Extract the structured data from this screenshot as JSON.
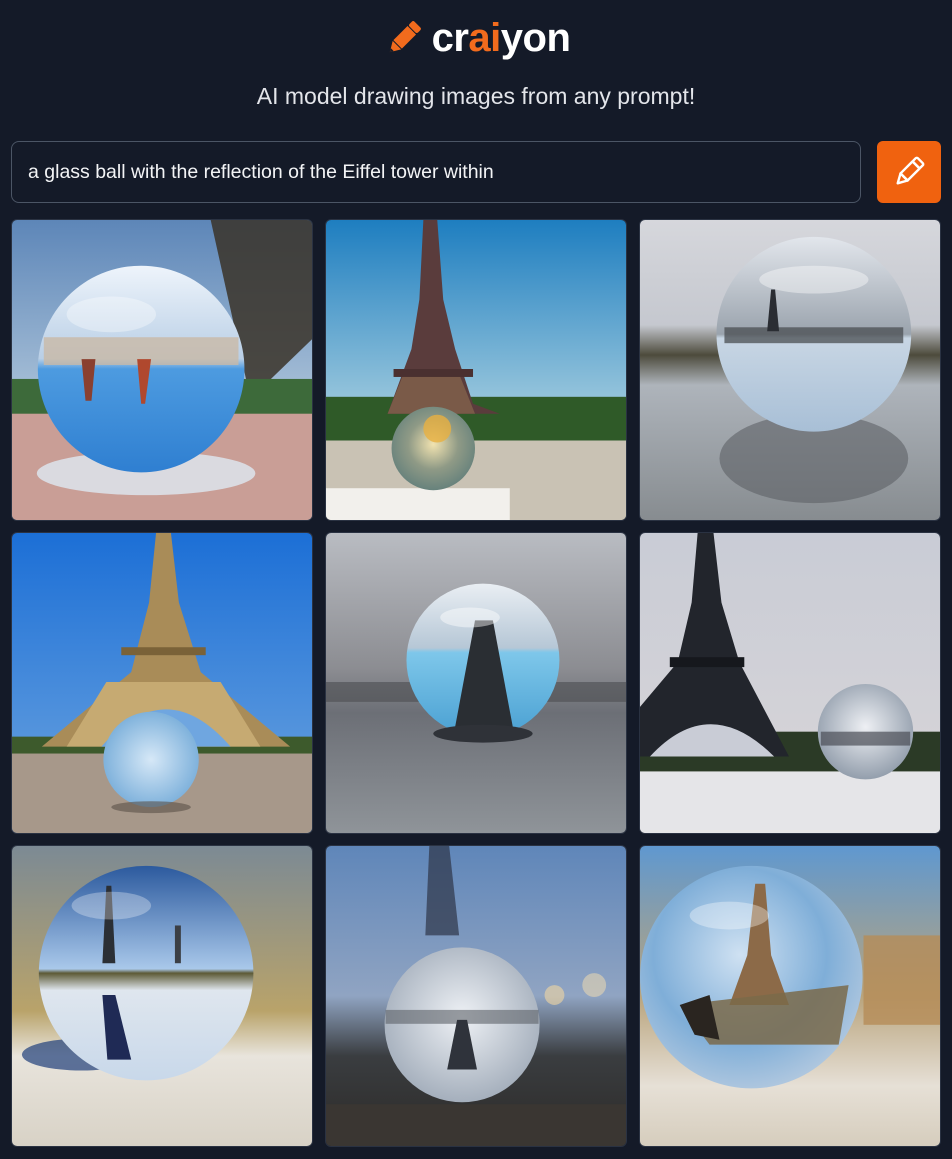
{
  "header": {
    "brand_prefix": "cr",
    "brand_accent": "ai",
    "brand_suffix": "yon",
    "brand_icon": "pencil-icon",
    "tagline": "AI model drawing images from any prompt!"
  },
  "prompt": {
    "value": "a glass ball with the reflection of the Eiffel tower within",
    "draw_button_icon": "pencil-icon"
  },
  "colors": {
    "background": "#141a28",
    "accent": "#f26b1d",
    "button": "#f0620f",
    "input_border": "#4b5565"
  },
  "results": {
    "count": 9,
    "columns": 3
  }
}
